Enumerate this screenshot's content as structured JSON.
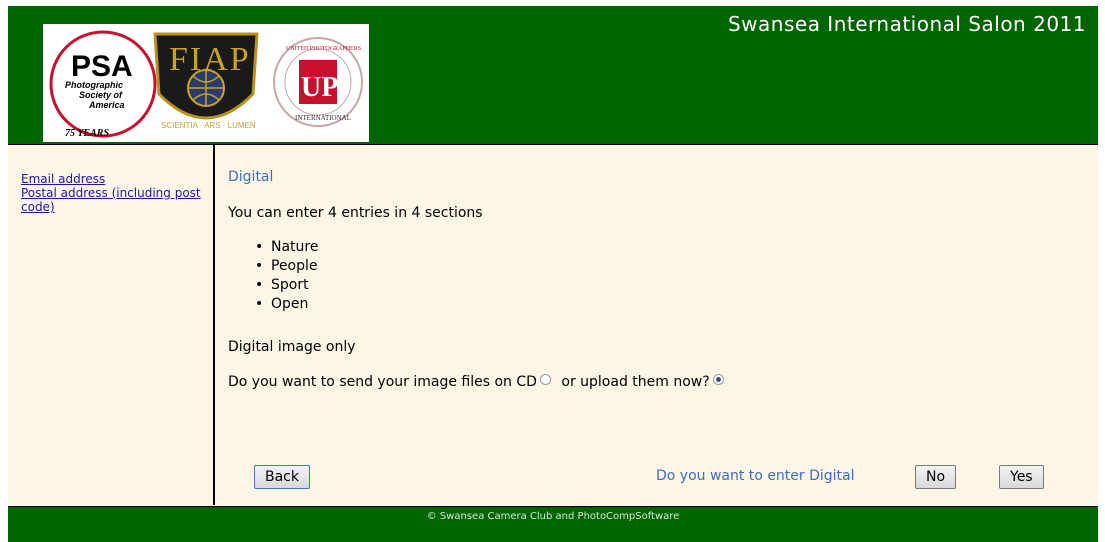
{
  "header": {
    "title": "Swansea International Salon 2011",
    "logos": {
      "psa": {
        "icon": "psa-logo",
        "big": "PSA",
        "lines": [
          "Photographic",
          "Society of",
          "America"
        ],
        "years": "75 YEARS"
      },
      "fiap": {
        "icon": "fiap-logo",
        "top": "FIAP",
        "motto": "SCIENTIA · ARS · LUMEN"
      },
      "up": {
        "icon": "up-logo",
        "mark": "UP",
        "ring_top": "UNITED PHOTOGRAPHERS",
        "ring_bottom": "INTERNATIONAL"
      }
    }
  },
  "sidebar": {
    "links": [
      {
        "label": "Email address"
      },
      {
        "label": "Postal address (including post code)"
      }
    ]
  },
  "main": {
    "section_title": "Digital",
    "entries_text": "You can enter 4 entries in 4 sections",
    "sections": [
      "Nature",
      "People",
      "Sport",
      "Open"
    ],
    "note": "Digital image only",
    "send_question": "Do you want to send your image files on CD",
    "upload_option": "or upload them now?",
    "cd_selected": false,
    "upload_selected": true,
    "enter_question": "Do you want to enter Digital",
    "back_label": "Back",
    "no_label": "No",
    "yes_label": "Yes"
  },
  "footer": {
    "text": "© Swansea Camera Club  and PhotoCompSoftware"
  },
  "colors": {
    "header_green": "#006400",
    "panel_bg": "#fdf5e6",
    "accent_blue": "#3d6fbf",
    "link_blue": "#1a1aa6"
  }
}
